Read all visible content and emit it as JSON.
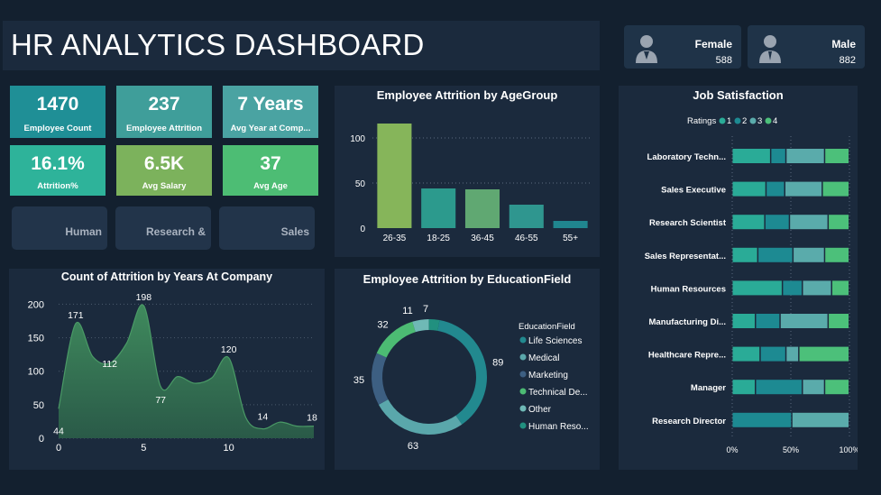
{
  "header": {
    "title": "HR ANALYTICS DASHBOARD"
  },
  "gender": {
    "female": {
      "label": "Female",
      "value": "588"
    },
    "male": {
      "label": "Male",
      "value": "882"
    }
  },
  "kpis": [
    {
      "value": "1470",
      "label": "Employee Count",
      "color": "#1f8f96"
    },
    {
      "value": "237",
      "label": "Employee Attrition",
      "color": "#3f9e9a"
    },
    {
      "value": "7 Years",
      "label": "Avg Year at Comp...",
      "color": "#4aa3a2"
    },
    {
      "value": "16.1%",
      "label": "Attrition%",
      "color": "#2eb39a"
    },
    {
      "value": "6.5K",
      "label": "Avg Salary",
      "color": "#7cb25c"
    },
    {
      "value": "37",
      "label": "Avg Age",
      "color": "#4dbd74"
    }
  ],
  "slicers": [
    "Human",
    "Research &",
    "Sales"
  ],
  "colors": {
    "r1": "#2aab97",
    "r2": "#1d8a92",
    "r3": "#5aabab",
    "r4": "#4cc07a"
  },
  "chart_data": [
    {
      "type": "bar",
      "title": "Employee Attrition by AgeGroup",
      "categories": [
        "26-35",
        "18-25",
        "36-45",
        "46-55",
        "55+"
      ],
      "values": [
        116,
        44,
        43,
        26,
        8
      ],
      "ylim": [
        0,
        120
      ],
      "yticks": [
        "0",
        "50",
        "100"
      ],
      "colors": [
        "#86b55a",
        "#2c9a8d",
        "#60a872",
        "#2f968f",
        "#20868f"
      ]
    },
    {
      "type": "area",
      "title": "Count of Attrition by Years At Company",
      "x": [
        0,
        1,
        2,
        3,
        4,
        5,
        6,
        7,
        8,
        9,
        10,
        11,
        12,
        13,
        14,
        15
      ],
      "values": [
        44,
        171,
        122,
        112,
        142,
        198,
        77,
        92,
        82,
        90,
        120,
        31,
        14,
        24,
        18,
        18
      ],
      "labels": [
        {
          "x": 0,
          "text": "44"
        },
        {
          "x": 1,
          "text": "171"
        },
        {
          "x": 3,
          "text": "112"
        },
        {
          "x": 5,
          "text": "198"
        },
        {
          "x": 6,
          "text": "77"
        },
        {
          "x": 10,
          "text": "120"
        },
        {
          "x": 12,
          "text": "14"
        },
        {
          "x": 15,
          "text": "18"
        }
      ],
      "xticks": [
        "0",
        "5",
        "10"
      ],
      "yticks": [
        "0",
        "50",
        "100",
        "150",
        "200"
      ],
      "ylim": [
        0,
        210
      ],
      "xlim": [
        0,
        15
      ]
    },
    {
      "type": "pie",
      "title": "Employee Attrition by EducationField",
      "legend_title": "EducationField",
      "slices": [
        {
          "name": "Life Sciences",
          "value": 89,
          "color": "#22898f"
        },
        {
          "name": "Medical",
          "value": 63,
          "color": "#5aa7ab"
        },
        {
          "name": "Marketing",
          "value": 35,
          "color": "#3d5f82"
        },
        {
          "name": "Technical De...",
          "value": 32,
          "color": "#4cbb73"
        },
        {
          "name": "Other",
          "value": 11,
          "color": "#6fb9b6"
        },
        {
          "name": "Human Reso...",
          "value": 7,
          "color": "#21907f"
        }
      ]
    },
    {
      "type": "bar",
      "title": "Job Satisfaction",
      "legend_title": "Ratings",
      "series_names": [
        "1",
        "2",
        "3",
        "4"
      ],
      "categories": [
        "Laboratory Techn...",
        "Sales Executive",
        "Research Scientist",
        "Sales Representat...",
        "Human Resources",
        "Manufacturing Di...",
        "Healthcare Repre...",
        "Manager",
        "Research Director"
      ],
      "values": [
        [
          0.33,
          0.13,
          0.33,
          0.21
        ],
        [
          0.29,
          0.16,
          0.32,
          0.23
        ],
        [
          0.28,
          0.21,
          0.33,
          0.18
        ],
        [
          0.22,
          0.3,
          0.27,
          0.21
        ],
        [
          0.43,
          0.17,
          0.25,
          0.15
        ],
        [
          0.2,
          0.21,
          0.41,
          0.18
        ],
        [
          0.24,
          0.22,
          0.11,
          0.43
        ],
        [
          0.2,
          0.4,
          0.19,
          0.21
        ],
        [
          0.0,
          0.51,
          0.49,
          0.0
        ]
      ],
      "xticks": [
        "0%",
        "50%",
        "100%"
      ]
    }
  ]
}
